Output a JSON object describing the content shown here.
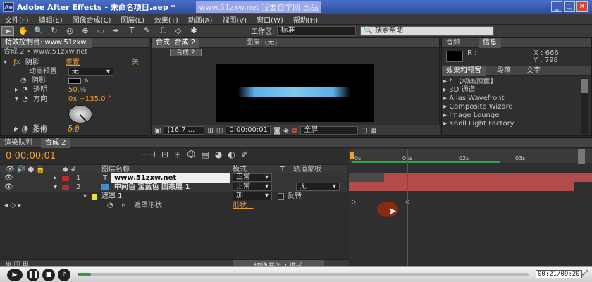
{
  "title": {
    "app": "Adobe After Effects",
    "doc": "- 未命名项目.aep *",
    "watermark": "www.51zxw.net 我要自学网 出品"
  },
  "menu": [
    "文件(F)",
    "编辑(E)",
    "图像合成(C)",
    "图层(L)",
    "效果(T)",
    "动画(A)",
    "视图(V)",
    "窗口(W)",
    "帮助(H)"
  ],
  "toolbar": {
    "workspace_label": "工作区:",
    "workspace_value": "标准",
    "search_placeholder": "搜索帮助"
  },
  "fx": {
    "tab": "特效控制台: www.51zxw.",
    "subtitle": "合成 2 • www.51zxw.net",
    "effect": "阴影",
    "reset": "重置",
    "about": "关",
    "preset_label": "动画预置",
    "preset_value": "无",
    "props": [
      {
        "n": "阴影",
        "v": ""
      },
      {
        "n": "透明",
        "v": "50.%"
      },
      {
        "n": "方向",
        "v": "0x +135.0 °"
      },
      {
        "n": "距离",
        "v": "5.0"
      },
      {
        "n": "柔化",
        "v": "0.0"
      }
    ]
  },
  "viewer": {
    "tab1": "合成: 合成 2",
    "tab2": "图层: (无)",
    "chip": "合成 2",
    "zoom": "(16.7 ...",
    "time": "0:00:00:01",
    "res": "全屏"
  },
  "info": {
    "tab1": "音频",
    "tab2": "信息",
    "r": "R :",
    "x": "X : 666",
    "y": "Y : 798"
  },
  "presets": {
    "tabs": [
      "效果和预置",
      "段落",
      "文字"
    ],
    "items": [
      "* 【动画预置】",
      "3D 通道",
      "Alias|Wavefront",
      "Composite Wizard",
      "Image Lounge",
      "Knoll Light Factory"
    ]
  },
  "timeline": {
    "tab1": "渲染队列",
    "tab2": "合成 2",
    "time": "0:00:00:01",
    "col_name": "图层名称",
    "col_mode": "模式",
    "col_t": "T",
    "col_track": "轨道蒙板",
    "rulers": [
      "0s",
      "01s",
      "02s",
      "03s"
    ],
    "layers": [
      {
        "num": "1",
        "name": "www.51zxw.net",
        "mode": "正常",
        "color": "#b03030"
      },
      {
        "num": "2",
        "name": "中间色 宝蓝色 固态层 1",
        "mode": "正常",
        "color": "#b03030",
        "track": "无"
      }
    ],
    "mask": {
      "name": "遮罩 1",
      "mode": "加",
      "invert": "反转"
    },
    "maskshape": {
      "name": "遮罩形状",
      "value": "形状..."
    },
    "switch": "切换开关 / 模式"
  },
  "player": {
    "time": "00:21/09:20"
  }
}
